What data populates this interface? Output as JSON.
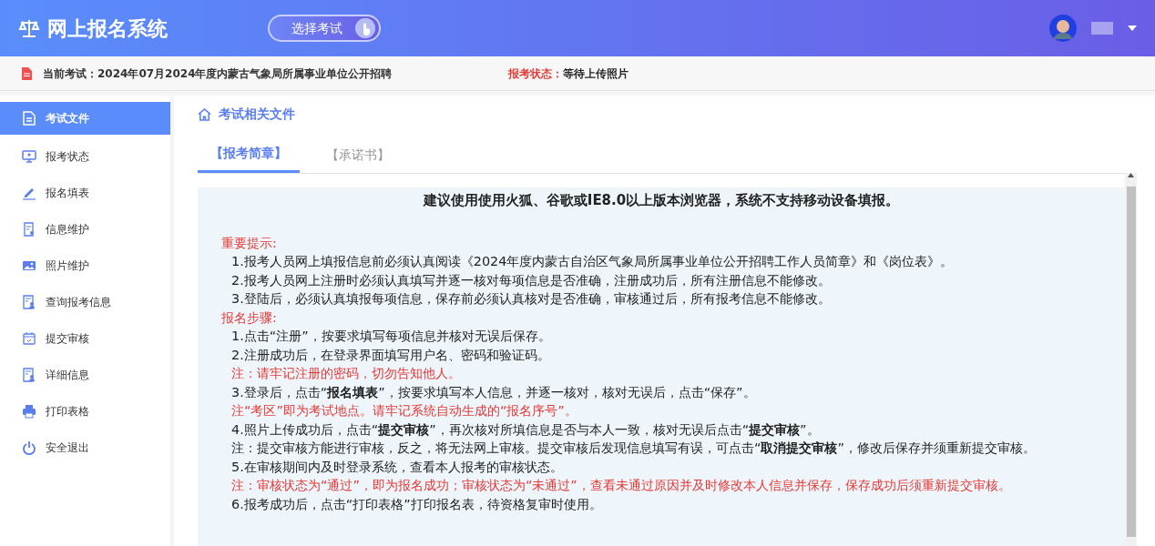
{
  "header": {
    "title": "网上报名系统",
    "select_button": "选择考试"
  },
  "exam_bar": {
    "label": "当前考试：",
    "exam": "2024年07月2024年度内蒙古气象局所属事业单位公开招聘",
    "status_label": "报考状态：",
    "status": "等待上传照片"
  },
  "sidebar": {
    "items": [
      {
        "label": "考试文件",
        "selected": true
      },
      {
        "label": "报考状态",
        "selected": false
      },
      {
        "label": "报名填表",
        "selected": false
      },
      {
        "label": "信息维护",
        "selected": false
      },
      {
        "label": "照片维护",
        "selected": false
      },
      {
        "label": "查询报考信息",
        "selected": false
      },
      {
        "label": "提交审核",
        "selected": false
      },
      {
        "label": "详细信息",
        "selected": false
      },
      {
        "label": "打印表格",
        "selected": false
      },
      {
        "label": "安全退出",
        "selected": false
      }
    ]
  },
  "page_title": "考试相关文件",
  "tabs": [
    {
      "label": "【报考简章】",
      "selected": true
    },
    {
      "label": "【承诺书】",
      "selected": false
    }
  ],
  "document": {
    "notice": "建议使用使用火狐、谷歌或IE8.0以上版本浏览器，**系统不支持移动设备填报。**",
    "lines": [
      {
        "kind": "heading",
        "text": "重要提示:"
      },
      {
        "kind": "item",
        "text": "1.报考人员网上填报信息前必须认真阅读《2024年度内蒙古自治区气象局所属事业单位公开招聘工作人员简章》和《岗位表》。"
      },
      {
        "kind": "item",
        "text": "2.报考人员网上注册时必须认真填写并逐一核对每项信息是否准确，注册成功后，所有注册信息不能修改。"
      },
      {
        "kind": "item",
        "text": "3.登陆后，必须认真填报每项信息，保存前必须认真核对是否准确，审核通过后，所有报考信息不能修改。"
      },
      {
        "kind": "heading",
        "text": "报名步骤:"
      },
      {
        "kind": "item",
        "text": "1.点击“注册”，按要求填写每项信息并核对无误后保存。"
      },
      {
        "kind": "item",
        "text": "2.注册成功后，在登录界面填写用户名、密码和验证码。"
      },
      {
        "kind": "note",
        "text": "注：请牢记注册的密码，切勿告知他人。"
      },
      {
        "kind": "item",
        "text": "3.登录后，点击“**报名填表**”，按要求填写本人信息，并逐一核对，核对无误后，点击“保存”。"
      },
      {
        "kind": "note",
        "text": "注“考区”即为考试地点。请牢记系统自动生成的“报名序号”。"
      },
      {
        "kind": "item",
        "text": "4.照片上传成功后，点击“**提交审核**”，再次核对所填信息是否与本人一致，核对无误后点击“**提交审核**”。"
      },
      {
        "kind": "item",
        "text": "注：提交审核方能进行审核，反之，将无法网上审核。提交审核后发现信息填写有误，可点击“**取消提交审核**”，修改后保存并须重新提交审核。"
      },
      {
        "kind": "item",
        "text": "5.在审核期间内及时登录系统，查看本人报考的审核状态。"
      },
      {
        "kind": "note",
        "text": "注：审核状态为“通过”，即为报名成功；审核状态为“未通过”，查看未通过原因并及时修改本人信息并保存，保存成功后须重新提交审核。"
      },
      {
        "kind": "item",
        "text": "6.报考成功后，点击“打印表格”打印报名表，待资格复审时使用。"
      }
    ]
  }
}
